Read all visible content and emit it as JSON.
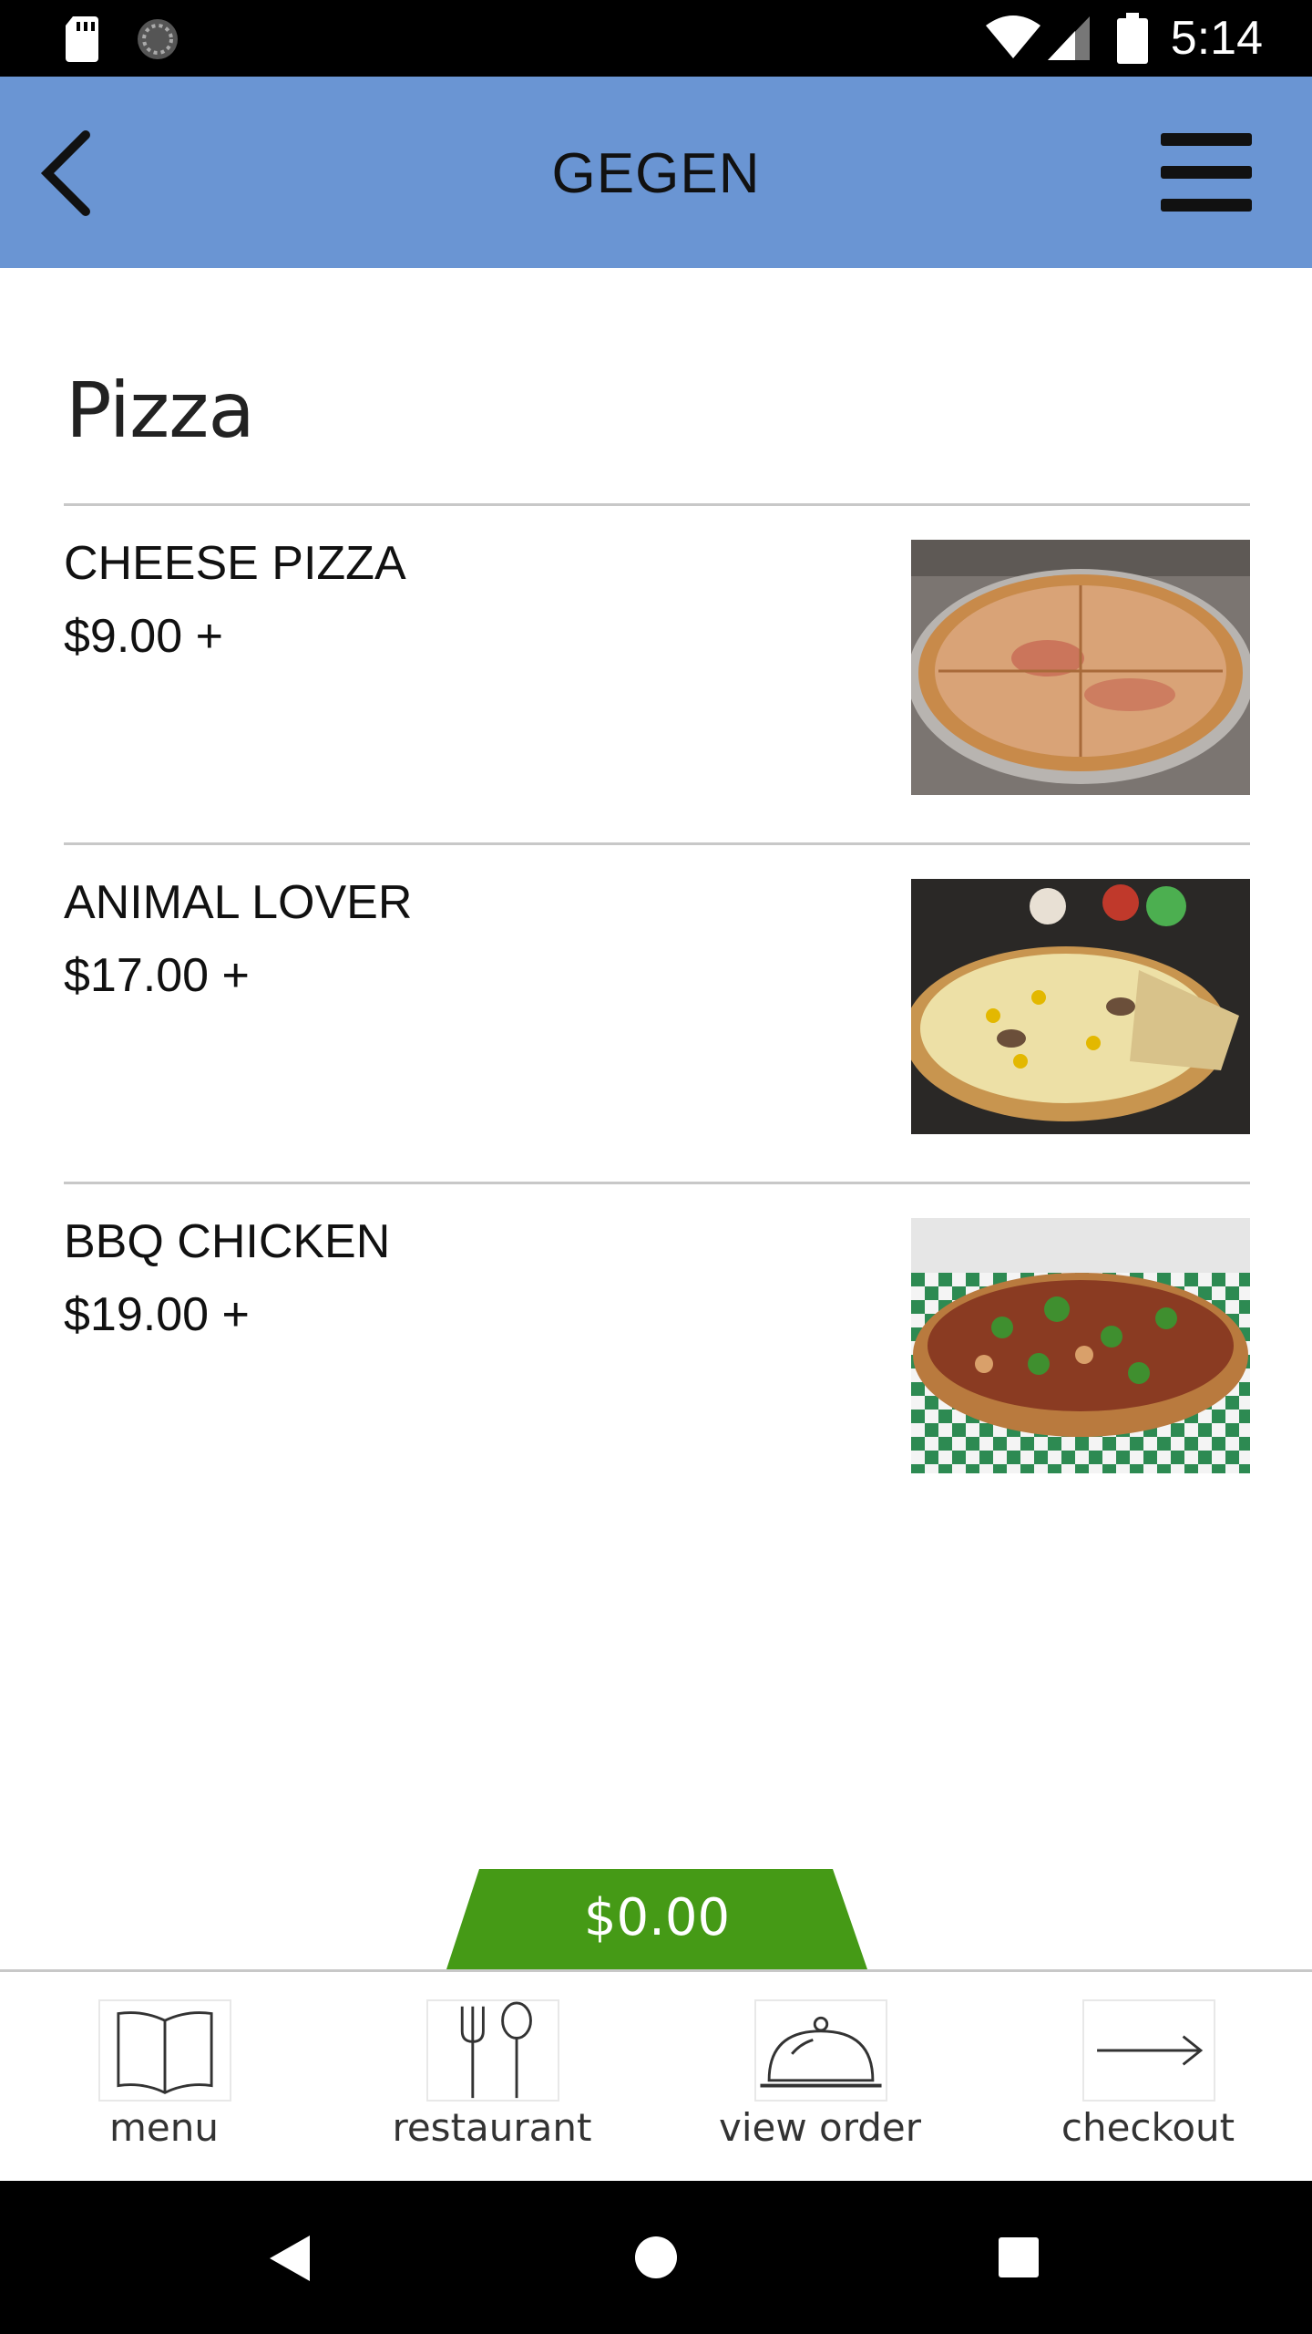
{
  "status_bar": {
    "time": "5:14"
  },
  "header": {
    "title": "GEGEN",
    "back_icon": "chevron-left-icon",
    "menu_icon": "hamburger-icon"
  },
  "category": {
    "title": "Pizza"
  },
  "items": [
    {
      "name": "CHEESE PIZZA",
      "price": "$9.00 +"
    },
    {
      "name": "ANIMAL LOVER",
      "price": "$17.00 +"
    },
    {
      "name": "BBQ CHICKEN",
      "price": "$19.00 +"
    }
  ],
  "cart": {
    "total": "$0.00",
    "color": "#459a16"
  },
  "bottom_nav": [
    {
      "label": "menu",
      "icon": "open-book-icon"
    },
    {
      "label": "restaurant",
      "icon": "fork-spoon-icon"
    },
    {
      "label": "view order",
      "icon": "cloche-icon"
    },
    {
      "label": "checkout",
      "icon": "arrow-right-icon"
    }
  ],
  "colors": {
    "header_bg": "#6a95d3",
    "divider": "#c8c8c8"
  }
}
